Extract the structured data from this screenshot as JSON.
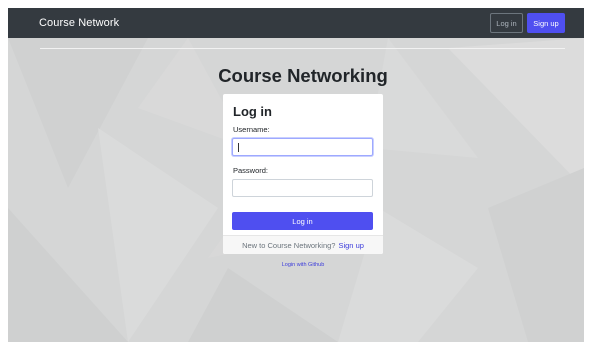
{
  "navbar": {
    "brand": "Course Network",
    "login_label": "Log in",
    "signup_label": "Sign up"
  },
  "page": {
    "title": "Course Networking"
  },
  "login_card": {
    "title": "Log in",
    "username_label": "Username:",
    "username_value": "",
    "password_label": "Password:",
    "password_value": "",
    "submit_label": "Log in",
    "footer_text": "New to Course Networking?",
    "footer_link": "Sign up"
  },
  "github_link": "Login with Github",
  "colors": {
    "navbar_bg": "#343a40",
    "accent": "#4f4ff0",
    "page_bg": "#d5d6d6",
    "link": "#3b3bdb"
  }
}
